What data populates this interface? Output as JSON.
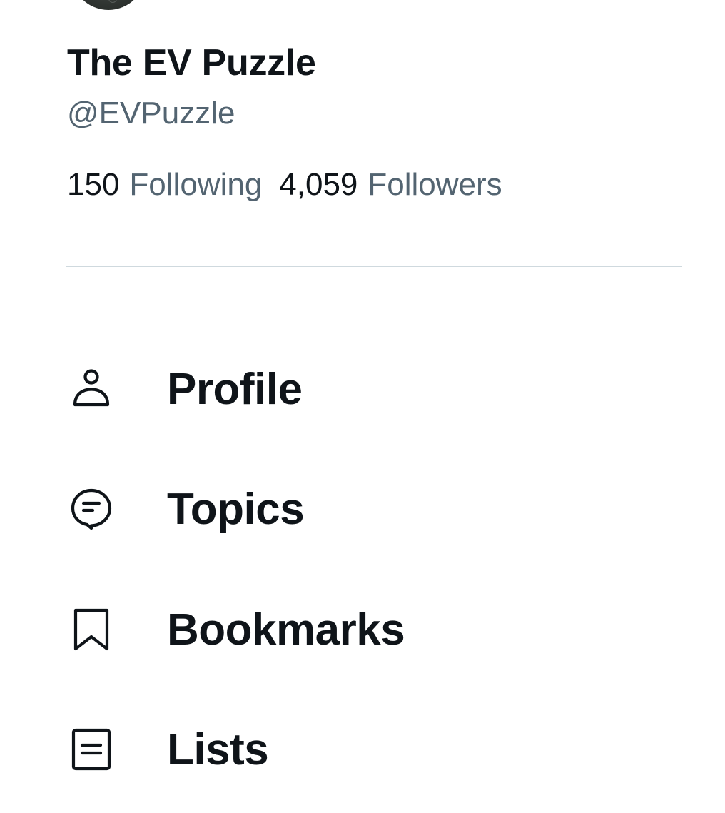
{
  "profile": {
    "display_name": "The EV Puzzle",
    "handle": "@EVPuzzle",
    "following_count": "150",
    "following_label": "Following",
    "followers_count": "4,059",
    "followers_label": "Followers"
  },
  "menu": {
    "items": [
      {
        "label": "Profile",
        "icon": "person-icon"
      },
      {
        "label": "Topics",
        "icon": "topics-icon"
      },
      {
        "label": "Bookmarks",
        "icon": "bookmark-icon"
      },
      {
        "label": "Lists",
        "icon": "lists-icon"
      }
    ]
  },
  "colors": {
    "text_primary": "#0f1419",
    "text_secondary": "#536471",
    "divider": "#cfd9de",
    "background": "#ffffff"
  }
}
